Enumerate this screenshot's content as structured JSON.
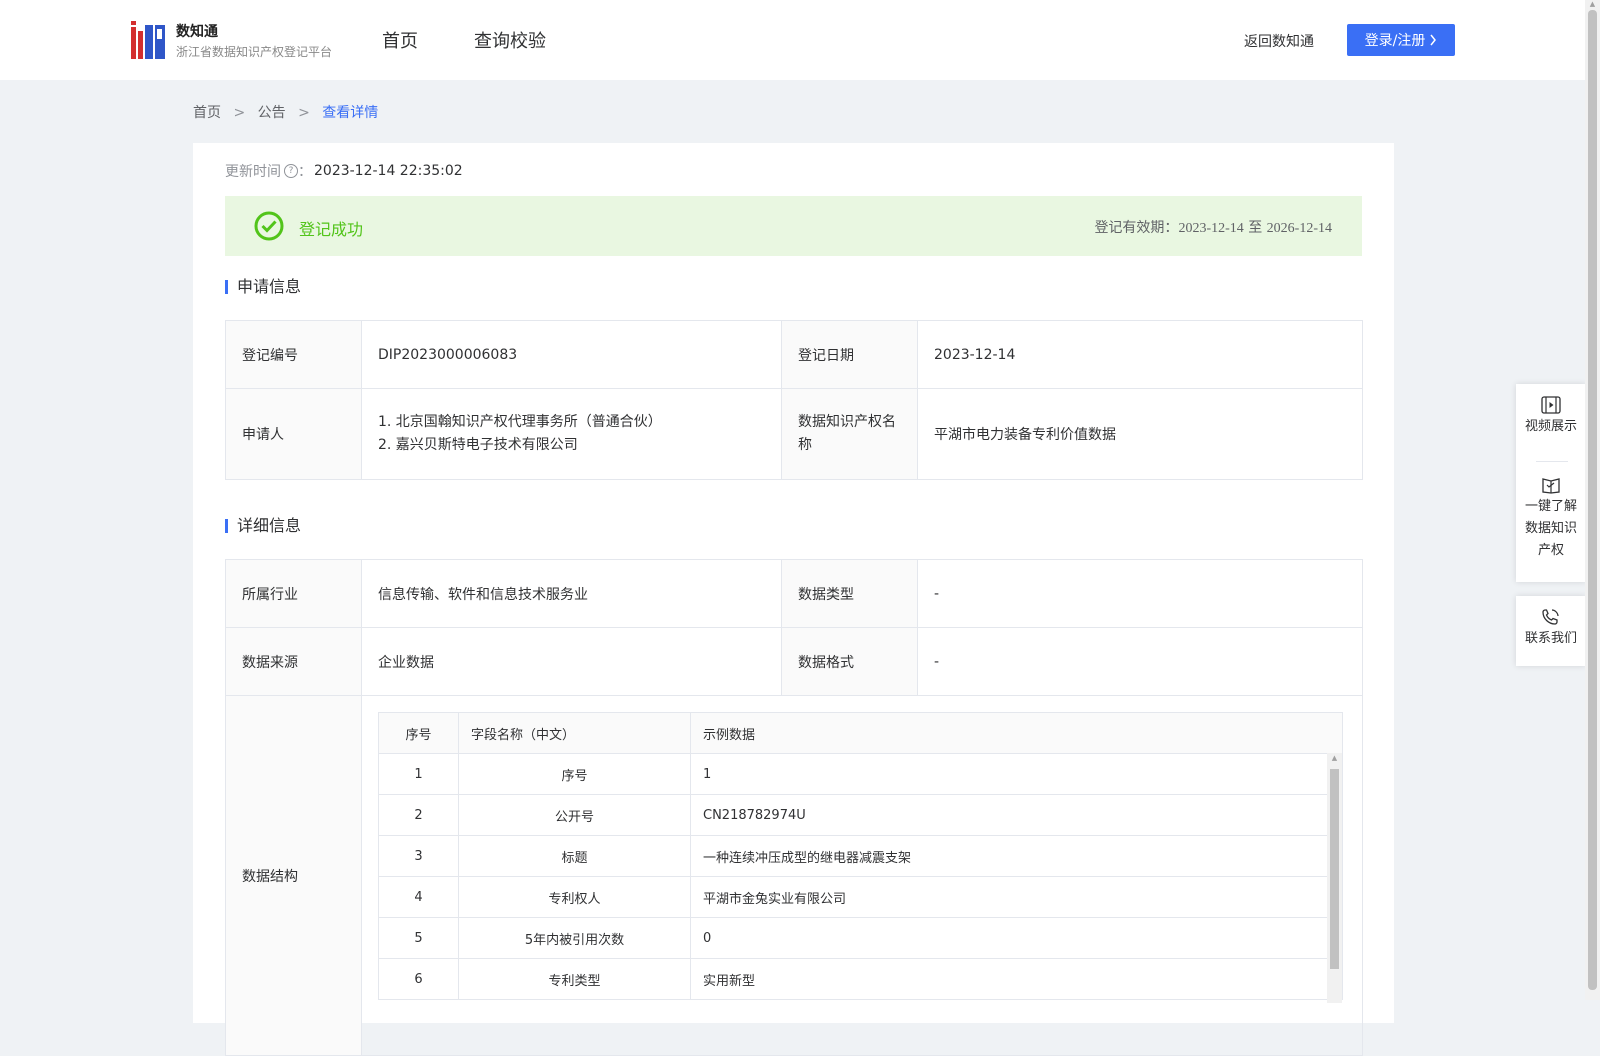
{
  "header": {
    "brand_title": "数知通",
    "brand_subtitle": "浙江省数据知识产权登记平台",
    "nav": [
      "首页",
      "查询校验"
    ],
    "return_link": "返回数知通",
    "login_button": "登录/注册"
  },
  "breadcrumb": {
    "items": [
      "首页",
      "公告",
      "查看详情"
    ],
    "separator": ">"
  },
  "update": {
    "label": "更新时间",
    "colon": "：",
    "value": "2023-12-14 22:35:02"
  },
  "status": {
    "text": "登记成功",
    "validity_label": "登记有效期：",
    "validity_from": "2023-12-14",
    "validity_to_word": "至",
    "validity_to": "2026-12-14",
    "color": "#52c41a"
  },
  "application_section": {
    "title": "申请信息",
    "reg_no_label": "登记编号",
    "reg_no": "DIP2023000006083",
    "reg_date_label": "登记日期",
    "reg_date": "2023-12-14",
    "applicant_label": "申请人",
    "applicants": [
      "1. 北京国翰知识产权代理事务所（普通合伙）",
      "2. 嘉兴贝斯特电子技术有限公司"
    ],
    "name_label": "数据知识产权名称",
    "name": "平湖市电力装备专利价值数据"
  },
  "detail_section": {
    "title": "详细信息",
    "industry_label": "所属行业",
    "industry": "信息传输、软件和信息技术服务业",
    "data_type_label": "数据类型",
    "data_type": "-",
    "source_label": "数据来源",
    "source": "企业数据",
    "format_label": "数据格式",
    "format": "-",
    "structure_label": "数据结构",
    "structure_headers": [
      "序号",
      "字段名称（中文）",
      "示例数据"
    ],
    "structure_rows": [
      [
        "1",
        "序号",
        "1"
      ],
      [
        "2",
        "公开号",
        "CN218782974U"
      ],
      [
        "3",
        "标题",
        "一种连续冲压成型的继电器减震支架"
      ],
      [
        "4",
        "专利权人",
        "平湖市金兔实业有限公司"
      ],
      [
        "5",
        "5年内被引用次数",
        "0"
      ],
      [
        "6",
        "专利类型",
        "实用新型"
      ]
    ]
  },
  "side_panel": {
    "video": "视频展示",
    "learn": [
      "一键了解",
      "数据知识",
      "产权"
    ],
    "contact": "联系我们"
  },
  "colors": {
    "accent": "#3a6ff5",
    "success_bg": "#e9f7e1"
  }
}
